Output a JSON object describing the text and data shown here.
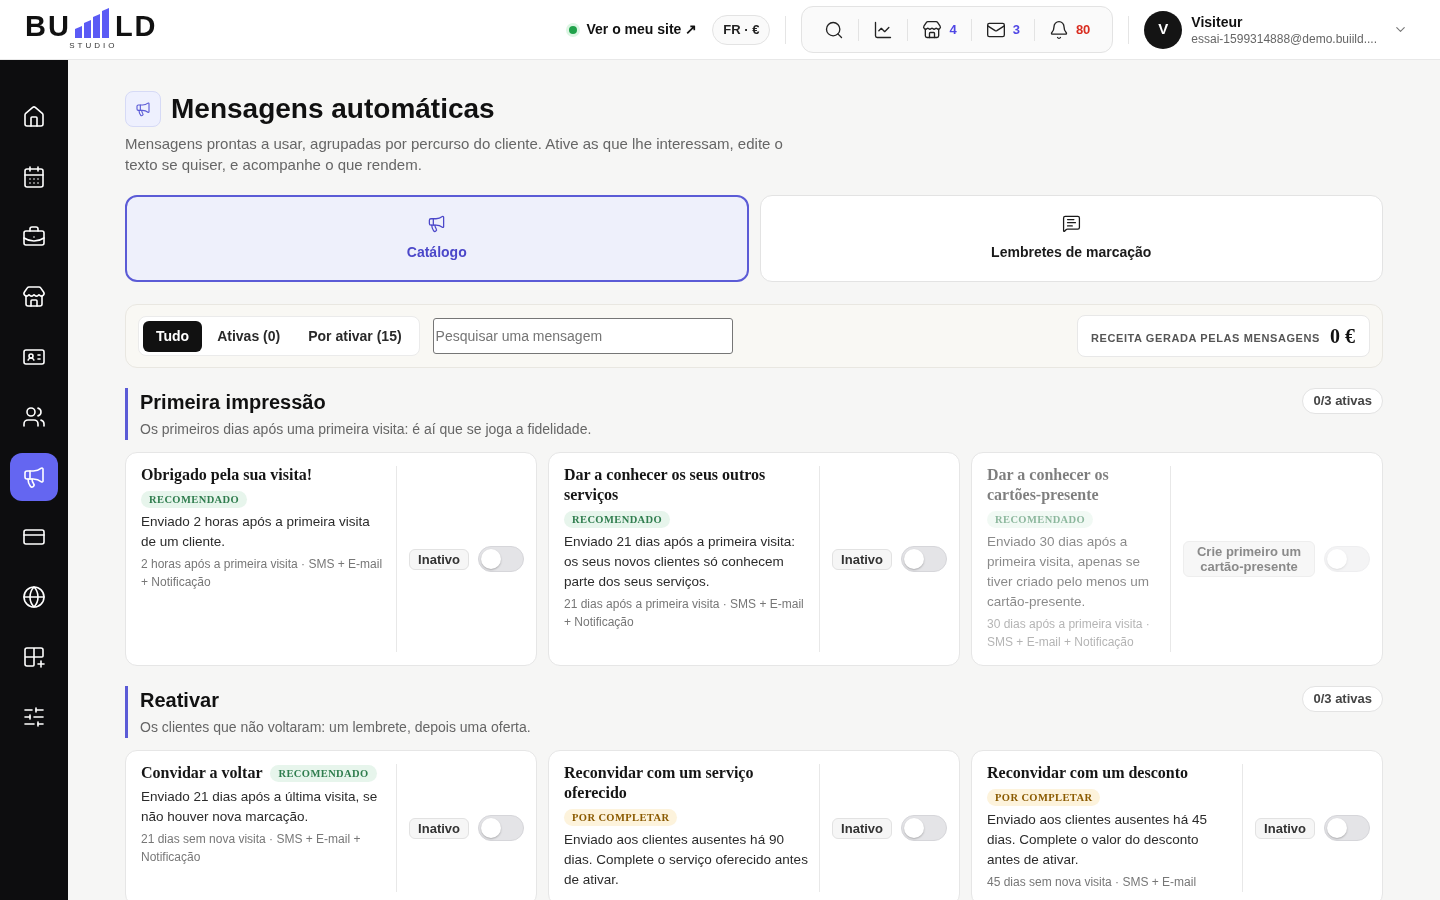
{
  "header": {
    "logo": {
      "left": "BU",
      "right": "LD",
      "tagline": "STUDIO"
    },
    "site_link": {
      "label": "Ver o meu site ↗",
      "online": true
    },
    "locale": {
      "label": "FR · €"
    },
    "tools": [
      {
        "kind": "search"
      },
      {
        "kind": "stats"
      },
      {
        "kind": "shop",
        "count": "4"
      },
      {
        "kind": "mail",
        "count": "3"
      },
      {
        "kind": "notifications",
        "count": "80"
      }
    ],
    "user": {
      "initial": "V",
      "name": "Visiteur",
      "email": "essai-1599314888@demo.buiild...."
    }
  },
  "sidebar": {
    "items": [
      {
        "selected": false
      },
      {
        "selected": false
      },
      {
        "selected": false
      },
      {
        "selected": false
      },
      {
        "selected": false
      },
      {
        "selected": false
      },
      {
        "selected": true
      },
      {
        "selected": false
      },
      {
        "selected": false
      },
      {
        "selected": false
      },
      {
        "selected": false
      }
    ]
  },
  "page": {
    "title": "Mensagens automáticas",
    "subtitle": "Mensagens prontas a usar, agrupadas por percurso do cliente. Ative as que lhe interessam, edite o texto se quiser, e acompanhe o que rendem."
  },
  "views": [
    {
      "label": "Catálogo",
      "selected": true
    },
    {
      "label": "Lembretes de marcação",
      "selected": false
    }
  ],
  "filters": {
    "segments": [
      {
        "label": "Tudo",
        "selected": true
      },
      {
        "label": "Ativas (0)",
        "selected": false
      },
      {
        "label": "Por ativar (15)",
        "selected": false
      }
    ],
    "search": {
      "placeholder": "Pesquisar uma mensagem"
    },
    "revenue": {
      "label": "RECEITA GERADA PELAS MENSAGENS",
      "value": "0 €"
    }
  },
  "sections": [
    {
      "title": "Primeira impressão",
      "description": "Os primeiros dias após uma primeira visita: é aí que se joga a fidelidade.",
      "active_count": "0/3 ativas",
      "messages": [
        {
          "title": "Obrigado pela sua visita!",
          "tag": {
            "label": "RECOMENDADO",
            "kind": "recommended"
          },
          "description": "Enviado 2 horas após a primeira visita de um cliente.",
          "meta": "2 horas após a primeira visita · SMS + E-mail + Notificação",
          "status": "Inativo",
          "on": false,
          "disabled": false
        },
        {
          "title": "Dar a conhecer os seus outros serviços",
          "tag": {
            "label": "RECOMENDADO",
            "kind": "recommended"
          },
          "description": "Enviado 21 dias após a primeira visita: os seus novos clientes só conhecem parte dos seus serviços.",
          "meta": "21 dias após a primeira visita · SMS + E-mail + Notificação",
          "status": "Inativo",
          "on": false,
          "disabled": false
        },
        {
          "title": "Dar a conhecer os cartões-presente",
          "tag": {
            "label": "RECOMENDADO",
            "kind": "recommended"
          },
          "description": "Enviado 30 dias após a primeira visita, apenas se tiver criado pelo menos um cartão-presente.",
          "meta": "30 dias após a primeira visita · SMS + E-mail + Notificação",
          "status": "Crie primeiro um cartão-presente",
          "on": false,
          "disabled": true
        }
      ]
    },
    {
      "title": "Reativar",
      "description": "Os clientes que não voltaram: um lembrete, depois uma oferta.",
      "active_count": "0/3 ativas",
      "messages": [
        {
          "title": "Convidar a voltar",
          "tag": {
            "label": "RECOMENDADO",
            "kind": "recommended"
          },
          "description": "Enviado 21 dias após a última visita, se não houver nova marcação.",
          "meta": "21 dias sem nova visita · SMS + E-mail + Notificação",
          "status": "Inativo",
          "on": false,
          "disabled": false
        },
        {
          "title": "Reconvidar com um serviço oferecido",
          "tag": {
            "label": "POR COMPLETAR",
            "kind": "incomplete"
          },
          "description": "Enviado aos clientes ausentes há 90 dias. Complete o serviço oferecido antes de ativar.",
          "status": "Inativo",
          "on": false,
          "disabled": false
        },
        {
          "title": "Reconvidar com um desconto",
          "tag": {
            "label": "POR COMPLETAR",
            "kind": "incomplete"
          },
          "description": "Enviado aos clientes ausentes há 45 dias. Complete o valor do desconto antes de ativar.",
          "meta": "45 dias sem nova visita · SMS + E-mail",
          "status": "Inativo",
          "on": false,
          "disabled": false
        }
      ]
    }
  ]
}
